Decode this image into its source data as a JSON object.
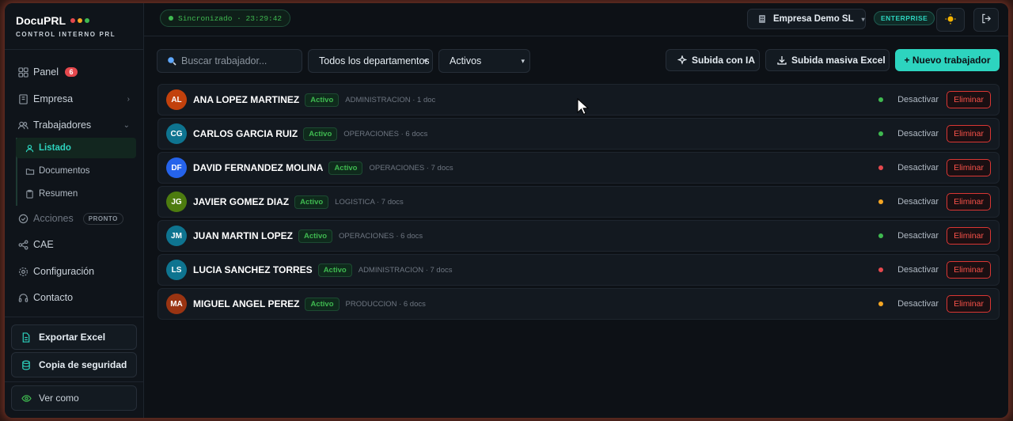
{
  "brand": {
    "name": "DocuPRL",
    "subtitle": "CONTROL INTERNO PRL",
    "dot_colors": [
      "#e5484d",
      "#f5a623",
      "#3fb950"
    ]
  },
  "sidebar": {
    "items": [
      {
        "label": "Panel",
        "icon": "grid-icon",
        "badge": "6"
      },
      {
        "label": "Empresa",
        "icon": "building-icon"
      },
      {
        "label": "Trabajadores",
        "icon": "users-icon"
      },
      {
        "label": "Acciones",
        "icon": "check-circle-icon",
        "badge": "PRONTO"
      },
      {
        "label": "CAE",
        "icon": "share-icon"
      },
      {
        "label": "Configuración",
        "icon": "gear-icon"
      },
      {
        "label": "Contacto",
        "icon": "headset-icon"
      }
    ],
    "sub_items": [
      {
        "label": "Listado",
        "icon": "user-icon"
      },
      {
        "label": "Documentos",
        "icon": "folder-icon"
      },
      {
        "label": "Resumen",
        "icon": "clipboard-icon"
      }
    ],
    "export_label": "Exportar Excel",
    "backup_label": "Copia de seguridad",
    "view_as_label": "Ver como"
  },
  "header": {
    "sync_text": "Sincronizado · 23:29:42",
    "company": "Empresa Demo SL",
    "plan": "ENTERPRISE"
  },
  "toolbar": {
    "search_placeholder": "Buscar trabajador...",
    "department_filter": "Todos los departamentos",
    "status_filter": "Activos",
    "ai_upload": "Subida con IA",
    "bulk_upload": "Subida masiva Excel",
    "new_worker": "+ Nuevo trabajador"
  },
  "workers": [
    {
      "initials": "AL",
      "name": "ANA LOPEZ MARTINEZ",
      "status": "Activo",
      "meta": "ADMINISTRACION · 1 doc",
      "avatar_color": "#c2410c",
      "dot_color": "#3fb950"
    },
    {
      "initials": "CG",
      "name": "CARLOS GARCIA RUIZ",
      "status": "Activo",
      "meta": "OPERACIONES · 6 docs",
      "avatar_color": "#0e7490",
      "dot_color": "#3fb950"
    },
    {
      "initials": "DF",
      "name": "DAVID FERNANDEZ MOLINA",
      "status": "Activo",
      "meta": "OPERACIONES · 7 docs",
      "avatar_color": "#2563eb",
      "dot_color": "#e5484d"
    },
    {
      "initials": "JG",
      "name": "JAVIER GOMEZ DIAZ",
      "status": "Activo",
      "meta": "LOGISTICA · 7 docs",
      "avatar_color": "#4d7c0f",
      "dot_color": "#f5a623"
    },
    {
      "initials": "JM",
      "name": "JUAN MARTIN LOPEZ",
      "status": "Activo",
      "meta": "OPERACIONES · 6 docs",
      "avatar_color": "#0e7490",
      "dot_color": "#3fb950"
    },
    {
      "initials": "LS",
      "name": "LUCIA SANCHEZ TORRES",
      "status": "Activo",
      "meta": "ADMINISTRACION · 7 docs",
      "avatar_color": "#0e7490",
      "dot_color": "#e5484d"
    },
    {
      "initials": "MA",
      "name": "MIGUEL ANGEL PEREZ",
      "status": "Activo",
      "meta": "PRODUCCION · 6 docs",
      "avatar_color": "#9a3412",
      "dot_color": "#f5a623"
    }
  ],
  "row_actions": {
    "deactivate": "Desactivar",
    "delete": "Eliminar"
  },
  "colors": {
    "accent": "#2dd4bf",
    "danger": "#f85149",
    "success": "#3fb950"
  }
}
